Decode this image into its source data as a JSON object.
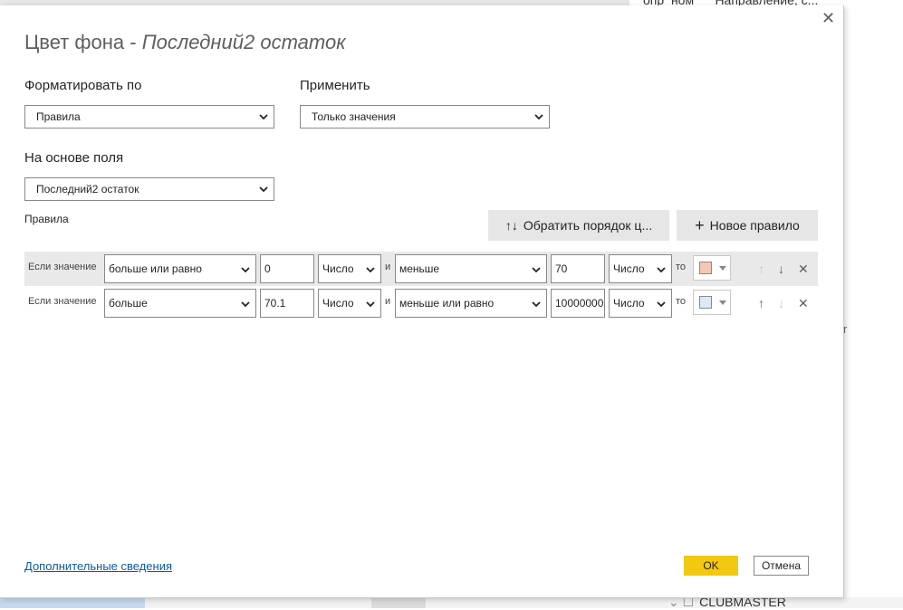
{
  "background": {
    "top_right_text": "опр_ном___Направление, с...",
    "right_char": "r",
    "bottom_text": "CLUBMASTER"
  },
  "dialog": {
    "title_main": "Цвет фона - ",
    "title_field": "Последний2 остаток",
    "close_glyph": "✕"
  },
  "format_by": {
    "label": "Форматировать по",
    "value": "Правила"
  },
  "apply_to": {
    "label": "Применить",
    "value": "Только значения"
  },
  "based_on": {
    "label": "На основе поля",
    "value": "Последний2 остаток"
  },
  "rules_section": {
    "label": "Правила",
    "reverse_button": "Обратить порядок ц...",
    "reverse_icon": "↑↓",
    "new_rule_button": "Новое правило",
    "new_rule_icon": "+"
  },
  "rules": [
    {
      "if_label": "Если значение",
      "op1": "больше или равно",
      "val1": "0",
      "type1": "Число",
      "and_label": "и",
      "op2": "меньше",
      "val2": "70",
      "type2": "Число",
      "then_label": "то",
      "color": "#f4c7b4"
    },
    {
      "if_label": "Если значение",
      "op1": "больше",
      "val1": "70.1",
      "type1": "Число",
      "and_label": "и",
      "op2": "меньше или равно",
      "val2": "10000000",
      "type2": "Число",
      "then_label": "то",
      "color": "#dce9f7"
    }
  ],
  "icons": {
    "up": "↑",
    "down": "↓",
    "delete": "✕"
  },
  "footer": {
    "learn_more": "Дополнительные сведения",
    "ok": "OK",
    "cancel": "Отмена"
  },
  "colors": {
    "accent": "#f2c811",
    "selected_row": "#e9e9e9",
    "link": "#0c5a9e"
  }
}
